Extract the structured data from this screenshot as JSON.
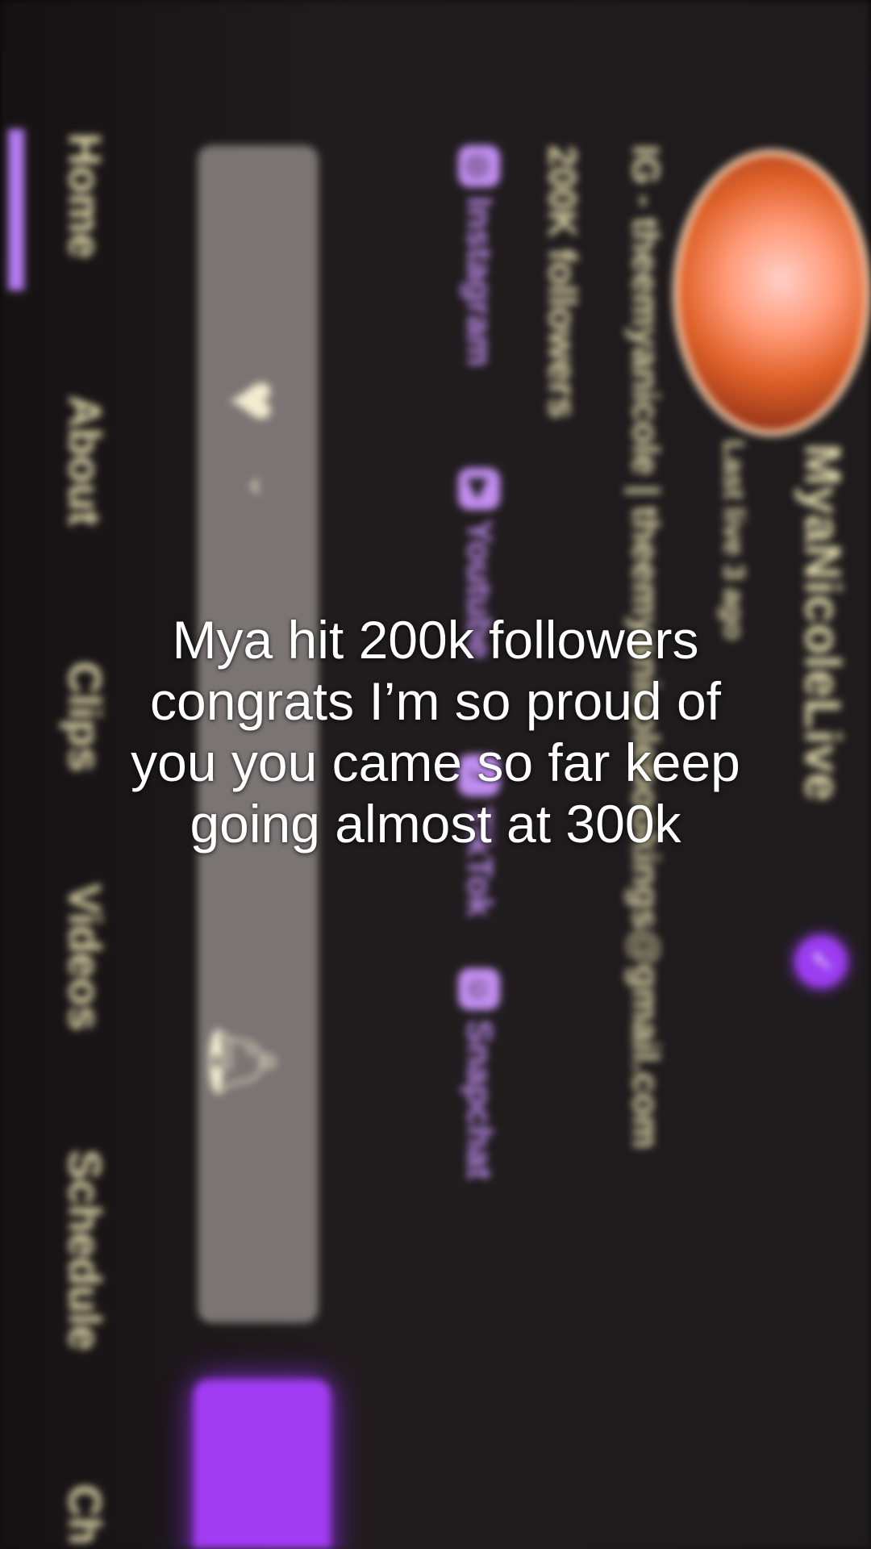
{
  "channel": {
    "display_name": "MyaNicoleLive",
    "last_live": "Last live 3 ago",
    "bio": "IG - theemyanicole | theemyanicolebookings@gmail.com",
    "followers": "200K followers"
  },
  "socials": [
    {
      "label": "Instagram",
      "icon": "instagram-icon"
    },
    {
      "label": "Youtube",
      "icon": "youtube-icon"
    },
    {
      "label": "TikTok",
      "icon": "tiktok-icon"
    },
    {
      "label": "Snapchat",
      "icon": "snapchat-icon"
    }
  ],
  "tabs": [
    {
      "label": "Home"
    },
    {
      "label": "About"
    },
    {
      "label": "Clips"
    },
    {
      "label": "Videos"
    },
    {
      "label": "Schedule"
    },
    {
      "label": "Ch"
    }
  ],
  "colors": {
    "accent": "#a23cf2",
    "text_yellow": "#e6dfb0",
    "link_purple": "#c18ef0"
  },
  "caption": {
    "lines": [
      "Mya hit 200k followers",
      "congrats I’m so proud of",
      "you you came so far keep",
      "going almost at 300k"
    ]
  }
}
